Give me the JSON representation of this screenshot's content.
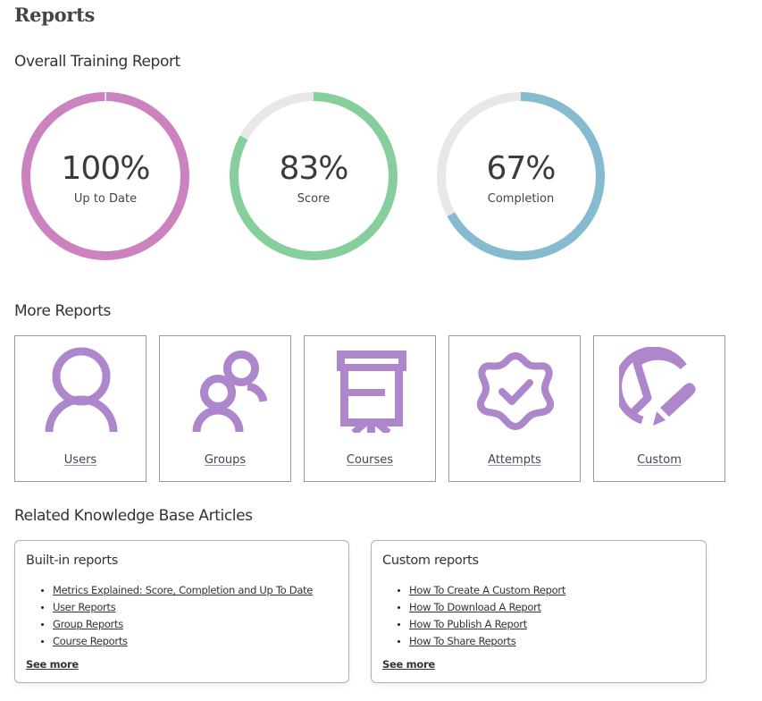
{
  "page": {
    "title": "Reports"
  },
  "overall": {
    "title": "Overall Training Report",
    "metrics": [
      {
        "value_text": "100%",
        "label": "Up to Date",
        "percent": 100,
        "color": "#cc82bf",
        "track_color": "#e8e8e8"
      },
      {
        "value_text": "83%",
        "label": "Score",
        "percent": 83,
        "color": "#86cf9c",
        "track_color": "#e8e8e8"
      },
      {
        "value_text": "67%",
        "label": "Completion",
        "percent": 67,
        "color": "#86bacf",
        "track_color": "#e8e8e8"
      }
    ]
  },
  "more_reports": {
    "title": "More Reports",
    "icon_color": "#ad86cc",
    "items": [
      {
        "label": "Users",
        "icon": "user-icon"
      },
      {
        "label": "Groups",
        "icon": "group-icon"
      },
      {
        "label": "Courses",
        "icon": "presentation-board-icon"
      },
      {
        "label": "Attempts",
        "icon": "badge-check-icon"
      },
      {
        "label": "Custom",
        "icon": "pie-chart-pencil-icon"
      }
    ]
  },
  "knowledge_base": {
    "title": "Related Knowledge Base Articles",
    "cards": [
      {
        "title": "Built-in reports",
        "links": [
          "Metrics Explained: Score, Completion and Up To Date",
          "User Reports",
          "Group Reports",
          "Course Reports"
        ],
        "see_more": "See more"
      },
      {
        "title": "Custom reports",
        "links": [
          "How To Create A Custom Report",
          "How To Download A Report",
          "How To Publish A Report",
          "How To Share Reports"
        ],
        "see_more": "See more"
      }
    ]
  }
}
